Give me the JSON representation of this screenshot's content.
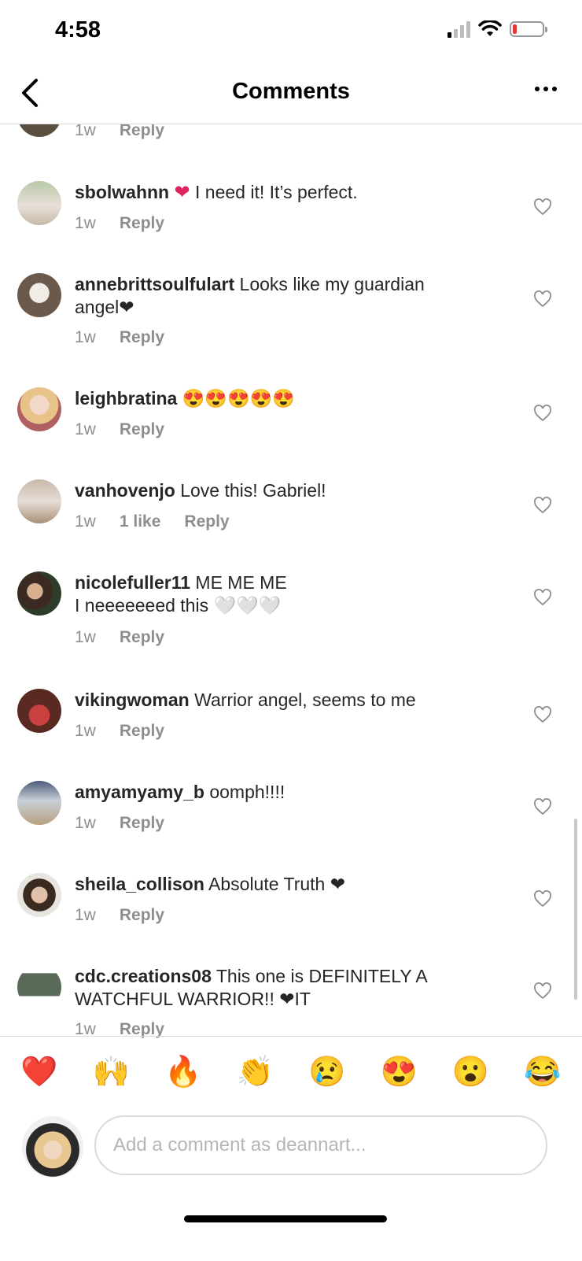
{
  "status": {
    "time": "4:58"
  },
  "header": {
    "title": "Comments"
  },
  "colors": {
    "heart_red": "#e0245e",
    "meta_gray": "#8e8e8e",
    "text": "#262626"
  },
  "partial_top": {
    "time": "1w",
    "reply": "Reply"
  },
  "comments": [
    {
      "username": "sbolwahnn",
      "text_pre": "❤",
      "text": " I need it!  It’s perfect.",
      "time": "1w",
      "reply": "Reply"
    },
    {
      "username": "annebrittsoulfulart",
      "text": " Looks like my guardian angel❤",
      "time": "1w",
      "reply": "Reply"
    },
    {
      "username": "leighbratina",
      "text": " 😍😍😍😍😍",
      "time": "1w",
      "reply": "Reply"
    },
    {
      "username": "vanhovenjo",
      "text": " Love this! Gabriel!",
      "time": "1w",
      "likes": "1 like",
      "reply": "Reply"
    },
    {
      "username": "nicolefuller11",
      "text": " ME ME ME",
      "text2": "I neeeeeeed this 🤍🤍🤍",
      "time": "1w",
      "reply": "Reply"
    },
    {
      "username": "vikingwoman",
      "text": " Warrior angel, seems to me",
      "time": "1w",
      "reply": "Reply"
    },
    {
      "username": "amyamyamy_b",
      "text": " oomph!!!!",
      "time": "1w",
      "reply": "Reply"
    },
    {
      "username": "sheila_collison",
      "text": " Absolute Truth ❤",
      "time": "1w",
      "reply": "Reply"
    },
    {
      "username": "cdc.creations08",
      "text": " This one is DEFINITELY A WATCHFUL WARRIOR!! ❤IT",
      "time": "1w",
      "reply": "Reply"
    }
  ],
  "reactions": [
    "❤️",
    "🙌",
    "🔥",
    "👏",
    "😢",
    "😍",
    "😮",
    "😂"
  ],
  "composer": {
    "placeholder": "Add a comment as deannart..."
  }
}
